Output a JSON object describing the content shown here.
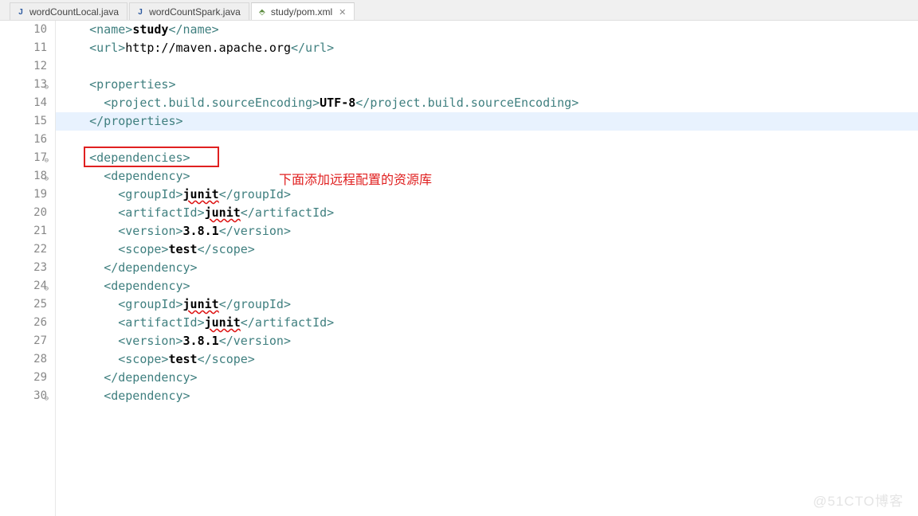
{
  "tabs": [
    {
      "label": "wordCountLocal.java",
      "active": false,
      "icon": "J"
    },
    {
      "label": "wordCountSpark.java",
      "active": false,
      "icon": "J"
    },
    {
      "label": "study/pom.xml",
      "active": true,
      "icon": "⬘"
    }
  ],
  "annotation": {
    "text": "下面添加远程配置的资源库"
  },
  "watermark": "@51CTO博客",
  "lines": [
    {
      "n": "10",
      "fold": "",
      "hl": false,
      "seg": [
        {
          "t": "    ",
          "c": ""
        },
        {
          "t": "<name>",
          "c": "tag"
        },
        {
          "t": "study",
          "c": "txt"
        },
        {
          "t": "</name>",
          "c": "tag"
        }
      ]
    },
    {
      "n": "11",
      "fold": "",
      "hl": false,
      "seg": [
        {
          "t": "    ",
          "c": ""
        },
        {
          "t": "<url>",
          "c": "tag"
        },
        {
          "t": "http://maven.apache.org",
          "c": "txt nb"
        },
        {
          "t": "</url>",
          "c": "tag"
        }
      ]
    },
    {
      "n": "12",
      "fold": "",
      "hl": false,
      "seg": [
        {
          "t": "",
          "c": ""
        }
      ]
    },
    {
      "n": "13",
      "fold": "⊖",
      "hl": false,
      "seg": [
        {
          "t": "    ",
          "c": ""
        },
        {
          "t": "<properties>",
          "c": "tag"
        }
      ]
    },
    {
      "n": "14",
      "fold": "",
      "hl": false,
      "seg": [
        {
          "t": "      ",
          "c": ""
        },
        {
          "t": "<project.build.sourceEncoding>",
          "c": "tag"
        },
        {
          "t": "UTF-8",
          "c": "txt"
        },
        {
          "t": "</project.build.sourceEncoding>",
          "c": "tag"
        }
      ]
    },
    {
      "n": "15",
      "fold": "",
      "hl": true,
      "seg": [
        {
          "t": "    ",
          "c": ""
        },
        {
          "t": "</properties>",
          "c": "tag"
        }
      ]
    },
    {
      "n": "16",
      "fold": "",
      "hl": false,
      "seg": [
        {
          "t": "",
          "c": ""
        }
      ]
    },
    {
      "n": "17",
      "fold": "⊖",
      "hl": false,
      "seg": [
        {
          "t": "    ",
          "c": ""
        },
        {
          "t": "<dependencies>",
          "c": "tag"
        }
      ]
    },
    {
      "n": "18",
      "fold": "⊖",
      "hl": false,
      "seg": [
        {
          "t": "      ",
          "c": ""
        },
        {
          "t": "<dependency>",
          "c": "tag"
        }
      ]
    },
    {
      "n": "19",
      "fold": "",
      "hl": false,
      "seg": [
        {
          "t": "        ",
          "c": ""
        },
        {
          "t": "<groupId>",
          "c": "tag"
        },
        {
          "t": "junit",
          "c": "txt err"
        },
        {
          "t": "</groupId>",
          "c": "tag"
        }
      ]
    },
    {
      "n": "20",
      "fold": "",
      "hl": false,
      "seg": [
        {
          "t": "        ",
          "c": ""
        },
        {
          "t": "<artifactId>",
          "c": "tag"
        },
        {
          "t": "junit",
          "c": "txt err"
        },
        {
          "t": "</artifactId>",
          "c": "tag"
        }
      ]
    },
    {
      "n": "21",
      "fold": "",
      "hl": false,
      "seg": [
        {
          "t": "        ",
          "c": ""
        },
        {
          "t": "<version>",
          "c": "tag"
        },
        {
          "t": "3.8.1",
          "c": "txt"
        },
        {
          "t": "</version>",
          "c": "tag"
        }
      ]
    },
    {
      "n": "22",
      "fold": "",
      "hl": false,
      "seg": [
        {
          "t": "        ",
          "c": ""
        },
        {
          "t": "<scope>",
          "c": "tag"
        },
        {
          "t": "test",
          "c": "txt"
        },
        {
          "t": "</scope>",
          "c": "tag"
        }
      ]
    },
    {
      "n": "23",
      "fold": "",
      "hl": false,
      "seg": [
        {
          "t": "      ",
          "c": ""
        },
        {
          "t": "</dependency>",
          "c": "tag"
        }
      ]
    },
    {
      "n": "24",
      "fold": "⊖",
      "hl": false,
      "seg": [
        {
          "t": "      ",
          "c": ""
        },
        {
          "t": "<dependency>",
          "c": "tag"
        }
      ]
    },
    {
      "n": "25",
      "fold": "",
      "hl": false,
      "seg": [
        {
          "t": "        ",
          "c": ""
        },
        {
          "t": "<groupId>",
          "c": "tag"
        },
        {
          "t": "junit",
          "c": "txt err"
        },
        {
          "t": "</groupId>",
          "c": "tag"
        }
      ]
    },
    {
      "n": "26",
      "fold": "",
      "hl": false,
      "seg": [
        {
          "t": "        ",
          "c": ""
        },
        {
          "t": "<artifactId>",
          "c": "tag"
        },
        {
          "t": "junit",
          "c": "txt err"
        },
        {
          "t": "</artifactId>",
          "c": "tag"
        }
      ]
    },
    {
      "n": "27",
      "fold": "",
      "hl": false,
      "seg": [
        {
          "t": "        ",
          "c": ""
        },
        {
          "t": "<version>",
          "c": "tag"
        },
        {
          "t": "3.8.1",
          "c": "txt"
        },
        {
          "t": "</version>",
          "c": "tag"
        }
      ]
    },
    {
      "n": "28",
      "fold": "",
      "hl": false,
      "seg": [
        {
          "t": "        ",
          "c": ""
        },
        {
          "t": "<scope>",
          "c": "tag"
        },
        {
          "t": "test",
          "c": "txt"
        },
        {
          "t": "</scope>",
          "c": "tag"
        }
      ]
    },
    {
      "n": "29",
      "fold": "",
      "hl": false,
      "seg": [
        {
          "t": "      ",
          "c": ""
        },
        {
          "t": "</dependency>",
          "c": "tag"
        }
      ]
    },
    {
      "n": "30",
      "fold": "⊖",
      "hl": false,
      "seg": [
        {
          "t": "      ",
          "c": ""
        },
        {
          "t": "<dependency>",
          "c": "tag"
        }
      ]
    }
  ]
}
